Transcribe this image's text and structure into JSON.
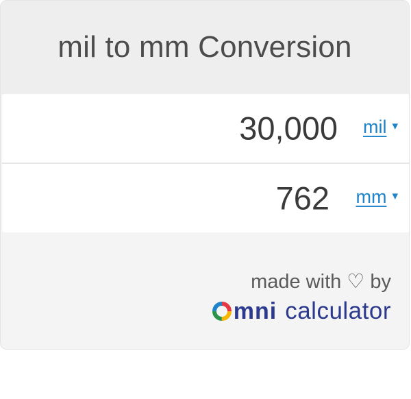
{
  "header": {
    "title": "mil to mm Conversion"
  },
  "inputs": [
    {
      "value": "30,000",
      "unit": "mil",
      "caret": "▾"
    },
    {
      "value": "762",
      "unit": "mm",
      "caret": "▾"
    }
  ],
  "footer": {
    "made_with": "made with ♡ by",
    "brand_logo_text": "mni",
    "brand_calc": "calculator"
  },
  "colors": {
    "header_bg": "#eeeeee",
    "link": "#1f84c9",
    "brand": "#2b3a8d",
    "logo_ring": [
      "#e63946",
      "#f5b700",
      "#2b9348",
      "#1f84c9"
    ]
  },
  "icons": {
    "unit_dropdown": "chevron-down-icon",
    "logo": "omni-logo-icon"
  }
}
